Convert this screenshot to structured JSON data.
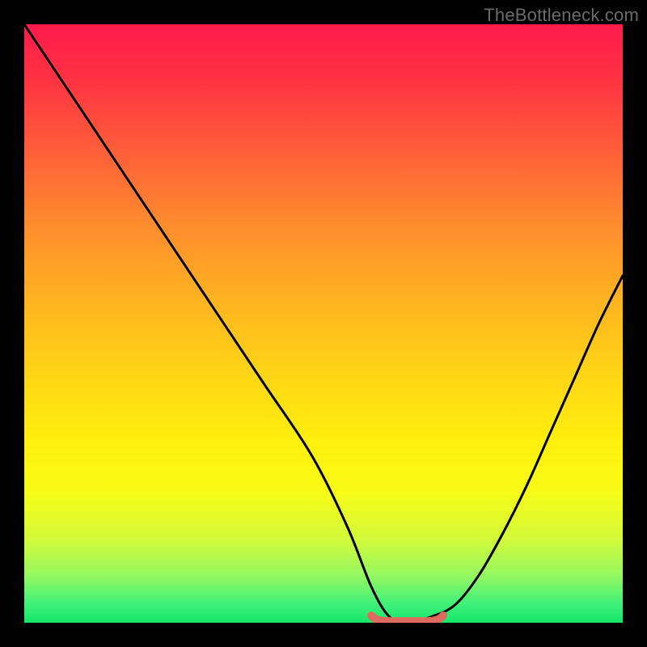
{
  "watermark": "TheBottleneck.com",
  "colors": {
    "frame": "#000000",
    "curve": "#000000",
    "marker": "#e06a5f",
    "gradient_stops": [
      "#ff1a4a",
      "#ff2f44",
      "#ff5a3a",
      "#ff8a2e",
      "#ffb321",
      "#ffd416",
      "#fff00d",
      "#f8fb16",
      "#d4fa3a",
      "#96f860",
      "#3ef07a",
      "#14e66a"
    ]
  },
  "chart_data": {
    "type": "line",
    "title": "",
    "xlabel": "",
    "ylabel": "",
    "xlim": [
      0,
      100
    ],
    "ylim": [
      0,
      100
    ],
    "series": [
      {
        "name": "bottleneck-curve",
        "x": [
          0,
          8,
          16,
          24,
          32,
          40,
          48,
          54,
          58,
          61,
          64,
          68,
          72,
          76,
          80,
          84,
          88,
          92,
          96,
          100
        ],
        "y": [
          100,
          88,
          76,
          64,
          52,
          40,
          28,
          16,
          6,
          1,
          0,
          1,
          3,
          8,
          15,
          23,
          32,
          41,
          50,
          58
        ]
      }
    ],
    "marker_segment": {
      "name": "optimal-range",
      "x": [
        58,
        70
      ],
      "y": [
        0.8,
        0.8
      ]
    },
    "annotations": []
  }
}
